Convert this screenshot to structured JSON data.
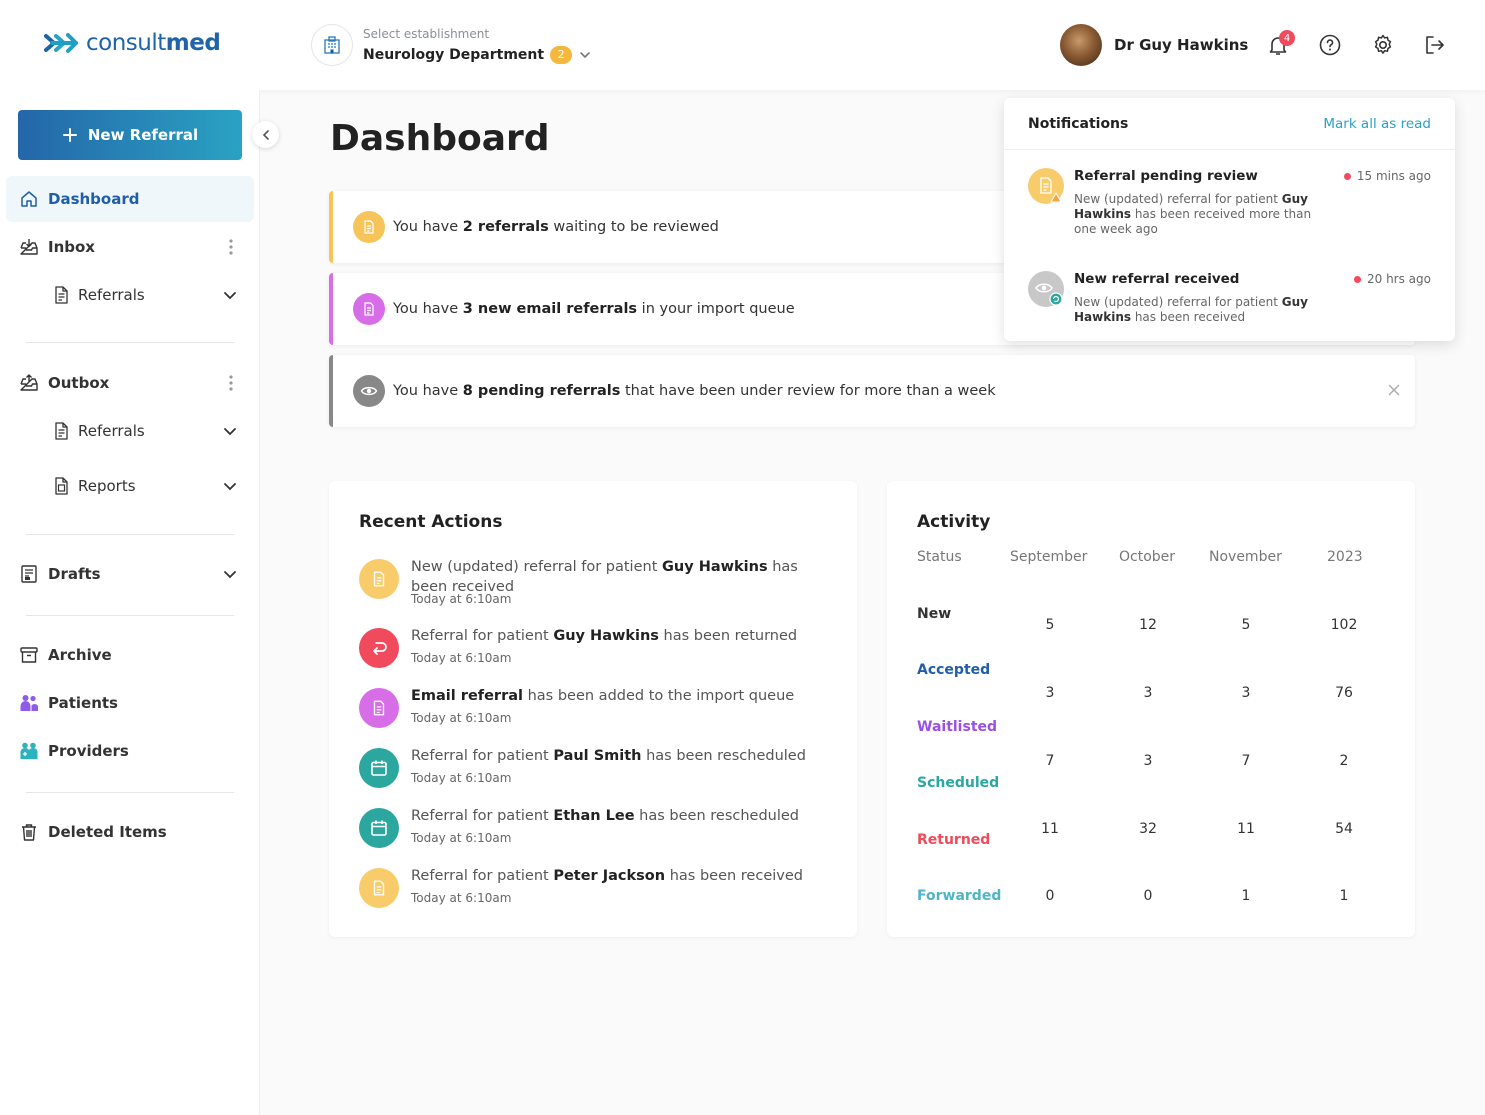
{
  "brand": {
    "logo_prefix": "consult",
    "logo_suffix": "med",
    "color": "#1f63a8"
  },
  "header": {
    "establishment_label": "Select establishment",
    "establishment_name": "Neurology Department",
    "establishment_count": "2",
    "user_name": "Dr Guy Hawkins",
    "notification_count": "4",
    "icons": [
      "bell-icon",
      "help-icon",
      "gear-icon",
      "logout-icon"
    ]
  },
  "sidebar": {
    "new_referral": "New Referral",
    "dashboard": "Dashboard",
    "inbox": "Inbox",
    "inbox_referrals": "Referrals",
    "outbox": "Outbox",
    "outbox_referrals": "Referrals",
    "outbox_reports": "Reports",
    "drafts": "Drafts",
    "archive": "Archive",
    "patients": "Patients",
    "providers": "Providers",
    "deleted": "Deleted Items"
  },
  "page": {
    "title": "Dashboard"
  },
  "alerts": [
    {
      "pre": "You have ",
      "bold": "2 referrals",
      "post": " waiting to be reviewed",
      "color": "#f7c45a"
    },
    {
      "pre": "You have ",
      "bold": "3 new email referrals",
      "post": " in your import queue",
      "color": "#d86de8"
    },
    {
      "pre": "You have ",
      "bold": "8 pending referrals",
      "post": " that have been under review for more than a week",
      "color": "#888888"
    }
  ],
  "recent_actions": {
    "title": "Recent Actions",
    "items": [
      {
        "pre": "New (updated) referral for patient ",
        "bold": "Guy Hawkins",
        "post": " has been received",
        "date": "Today at 6:10am"
      },
      {
        "pre": "Referral for patient ",
        "bold": "Guy Hawkins",
        "post": " has been returned",
        "date": "Today at 6:10am"
      },
      {
        "pre": "",
        "bold": "Email referral",
        "post": " has been added to the import queue",
        "date": "Today at 6:10am"
      },
      {
        "pre": "Referral for patient ",
        "bold": "Paul Smith",
        "post": " has been rescheduled",
        "date": "Today at 6:10am"
      },
      {
        "pre": "Referral for patient ",
        "bold": "Ethan Lee",
        "post": " has been rescheduled",
        "date": "Today at 6:10am"
      },
      {
        "pre": "Referral for patient ",
        "bold": "Peter Jackson",
        "post": " has been received",
        "date": "Today at 6:10am"
      }
    ]
  },
  "activity": {
    "title": "Activity",
    "headers": [
      "Status",
      "September",
      "October",
      "November",
      "2023"
    ],
    "rows": [
      {
        "status": "New",
        "color": "#333333",
        "values": [
          "5",
          "12",
          "5",
          "102"
        ]
      },
      {
        "status": "Accepted",
        "color": "#1f5ea8",
        "values": [
          "3",
          "3",
          "3",
          "76"
        ]
      },
      {
        "status": "Waitlisted",
        "color": "#9b4fe6",
        "values": [
          "7",
          "3",
          "7",
          "2"
        ]
      },
      {
        "status": "Scheduled",
        "color": "#2ba7a0",
        "values": [
          "11",
          "32",
          "11",
          "54"
        ]
      },
      {
        "status": "Returned",
        "color": "#f04a5c",
        "values": [
          "0",
          "0",
          "1",
          "1"
        ]
      },
      {
        "status": "Forwarded",
        "color": "#4fb4c8",
        "values": []
      }
    ]
  },
  "notifications": {
    "title": "Notifications",
    "mark_all": "Mark all as read",
    "items": [
      {
        "title": "Referral pending review",
        "time": "15 mins ago",
        "pre": "New (updated) referral for patient ",
        "bold": "Guy Hawkins",
        "post": " has been received more than one week ago"
      },
      {
        "title": "New referral received",
        "time": "20 hrs ago",
        "pre": "New (updated) referral for patient ",
        "bold": "Guy Hawkins",
        "post": " has been received"
      }
    ]
  }
}
